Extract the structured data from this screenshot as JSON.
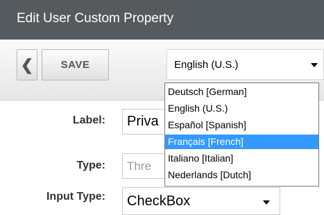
{
  "window": {
    "title": "Edit User Custom Property"
  },
  "toolbar": {
    "back_icon": "chevron-left-icon",
    "back_glyph": "❮",
    "save_label": "SAVE",
    "language_select": {
      "value": "English (U.S.)"
    }
  },
  "language_dropdown": {
    "options": [
      "Deutsch [German]",
      "English (U.S.)",
      "Español [Spanish]",
      "Français [French]",
      "Italiano [Italian]",
      "Nederlands [Dutch]"
    ],
    "highlighted_index": 3
  },
  "form": {
    "label_label": "Label:",
    "label_value": "Priva",
    "type_label": "Type:",
    "type_placeholder": "Thre",
    "input_type_label": "Input Type:",
    "input_type_value": "CheckBox"
  },
  "colors": {
    "titlebar": "#555a5e",
    "highlight": "#3399ff"
  }
}
